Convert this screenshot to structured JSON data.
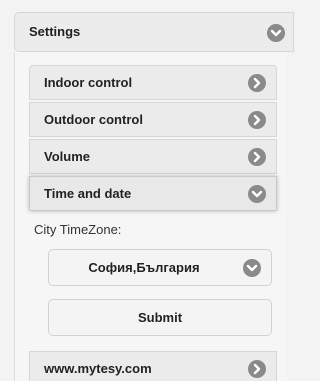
{
  "settings": {
    "title": "Settings"
  },
  "menu": {
    "items": [
      {
        "label": "Indoor control"
      },
      {
        "label": "Outdoor control"
      },
      {
        "label": "Volume"
      },
      {
        "label": "Time and date"
      }
    ],
    "link": {
      "label": "www.mytesy.com"
    }
  },
  "time_and_date": {
    "timezone_label": "City TimeZone:",
    "timezone_value": "София,България",
    "submit_label": "Submit"
  },
  "colors": {
    "icon_bg": "#8a8a8a",
    "item_bg": "#ebebeb",
    "page_bg": "#f3f3f3"
  }
}
